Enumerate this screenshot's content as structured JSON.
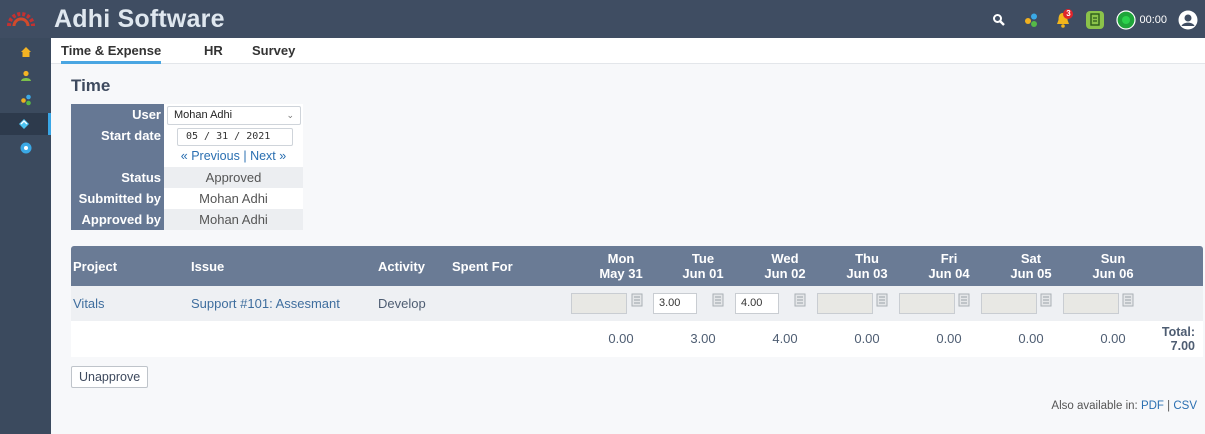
{
  "app": {
    "title": "Adhi Software"
  },
  "topbar": {
    "icons": [
      "search-icon",
      "projects-icon",
      "notification-bell-icon",
      "timesheet-icon",
      "timer-icon",
      "user-avatar-icon"
    ],
    "notification_count": "3",
    "timer": "00:00"
  },
  "sidebar": {
    "items": [
      {
        "icon": "home-icon"
      },
      {
        "icon": "users-icon"
      },
      {
        "icon": "projects-icon"
      },
      {
        "icon": "time-icon",
        "active": true
      },
      {
        "icon": "help-icon"
      }
    ]
  },
  "tabs": [
    {
      "label": "Time & Expense",
      "active": true
    },
    {
      "label": "HR"
    },
    {
      "label": "Survey"
    }
  ],
  "page": {
    "heading": "Time"
  },
  "info": {
    "user_label": "User",
    "user_value": "Mohan Adhi",
    "start_label": "Start date",
    "start_value": "05 / 31 / 2021",
    "prev": "« Previous",
    "sep": "|",
    "next": "Next »",
    "status_label": "Status",
    "status_value": "Approved",
    "submitted_label": "Submitted by",
    "submitted_value": "Mohan Adhi",
    "approved_label": "Approved by",
    "approved_value": "Mohan Adhi"
  },
  "timesheet": {
    "headers": {
      "project": "Project",
      "issue": "Issue",
      "activity": "Activity",
      "spent_for": "Spent For"
    },
    "days": [
      {
        "day": "Mon",
        "date": "May 31"
      },
      {
        "day": "Tue",
        "date": "Jun 01"
      },
      {
        "day": "Wed",
        "date": "Jun 02"
      },
      {
        "day": "Thu",
        "date": "Jun 03"
      },
      {
        "day": "Fri",
        "date": "Jun 04"
      },
      {
        "day": "Sat",
        "date": "Jun 05"
      },
      {
        "day": "Sun",
        "date": "Jun 06"
      }
    ],
    "row": {
      "project": "Vitals",
      "issue": "Support #101: Assesmant",
      "activity": "Develop",
      "hours": [
        "",
        "3.00",
        "4.00",
        "",
        "",
        "",
        ""
      ]
    },
    "totals": [
      "0.00",
      "3.00",
      "4.00",
      "0.00",
      "0.00",
      "0.00",
      "0.00"
    ],
    "total_label": "Total:",
    "total_value": "7.00"
  },
  "actions": {
    "unapprove": "Unapprove"
  },
  "footer": {
    "also": "Also available in:",
    "pdf": "PDF",
    "sep": "|",
    "csv": "CSV"
  }
}
